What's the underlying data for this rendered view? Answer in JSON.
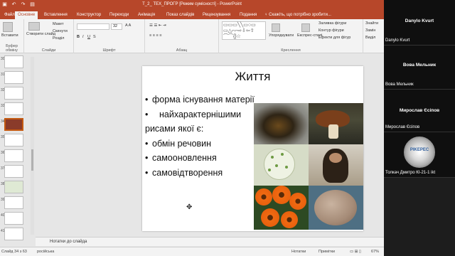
{
  "window": {
    "title": "T_2_ ТЕХ_ПРОГР [Режим сумісності] - PowerPoint"
  },
  "tabs": [
    "Файл",
    "Основне",
    "Вставлення",
    "Конструктор",
    "Переходи",
    "Анімація",
    "Показ слайдів",
    "Рецензування",
    "Подання"
  ],
  "active_tab": "Основне",
  "tell_me": "♀ Скажіть, що потрібно зробити...",
  "ribbon": {
    "clipboard": {
      "paste": "Вставити",
      "group": "Буфер обміну"
    },
    "slides": {
      "create": "Створити слайд",
      "layout": "Макет",
      "reset": "Скинути",
      "section": "Розділ",
      "group": "Слайди"
    },
    "font": {
      "size": "32",
      "group": "Шрифт"
    },
    "paragraph": {
      "group": "Абзац"
    },
    "drawing": {
      "arrange": "Упорядкувати",
      "quick_styles": "Експрес-стилі",
      "fill": "Заливка фігури",
      "outline": "Контур фігури",
      "effects": "Ефекти для фігур",
      "group": "Креслення"
    },
    "editing": {
      "find": "Знайти",
      "replace": "Замін",
      "select": "Виділ"
    }
  },
  "thumbnails": [
    {
      "number": "30",
      "selected": false
    },
    {
      "number": "31",
      "selected": false
    },
    {
      "number": "32",
      "selected": false
    },
    {
      "number": "33",
      "selected": false
    },
    {
      "number": "34",
      "selected": true
    },
    {
      "number": "35",
      "selected": false
    },
    {
      "number": "36",
      "selected": false
    },
    {
      "number": "37",
      "selected": false
    },
    {
      "number": "38",
      "selected": false
    },
    {
      "number": "39",
      "selected": false
    },
    {
      "number": "40",
      "selected": false
    },
    {
      "number": "41",
      "selected": false
    }
  ],
  "slide": {
    "title": "Життя",
    "bullets": [
      {
        "marker": "•",
        "text": "форма існування матерії"
      },
      {
        "marker": "•",
        "text": "найхарактернішими"
      },
      {
        "marker": "",
        "text": "рисами якої є:"
      },
      {
        "marker": "•",
        "text": "обмін речовин"
      },
      {
        "marker": "•",
        "text": "самооновлення"
      },
      {
        "marker": "•",
        "text": "самовідтворення"
      }
    ]
  },
  "notes_placeholder": "Нотатки до слайда",
  "status": {
    "slide_counter": "Слайд 34 з 63",
    "language": "російська",
    "notes": "Нотатки",
    "comments": "Примітки",
    "zoom": "67%"
  },
  "call": {
    "participants": [
      {
        "big": "Danylo Kvurt",
        "small": "Danylo Kvurt"
      },
      {
        "big": "Вова Мельник",
        "small": "Вова Мельник"
      },
      {
        "big": "Мирослав Єсіпов",
        "small": "Мирослав Єсіпов"
      },
      {
        "big": "",
        "small": "Толкач Дмитро КІ-21-1 ikt"
      }
    ]
  },
  "colors": {
    "accent": "#b7472a",
    "call_bg": "#0f0f0f"
  }
}
